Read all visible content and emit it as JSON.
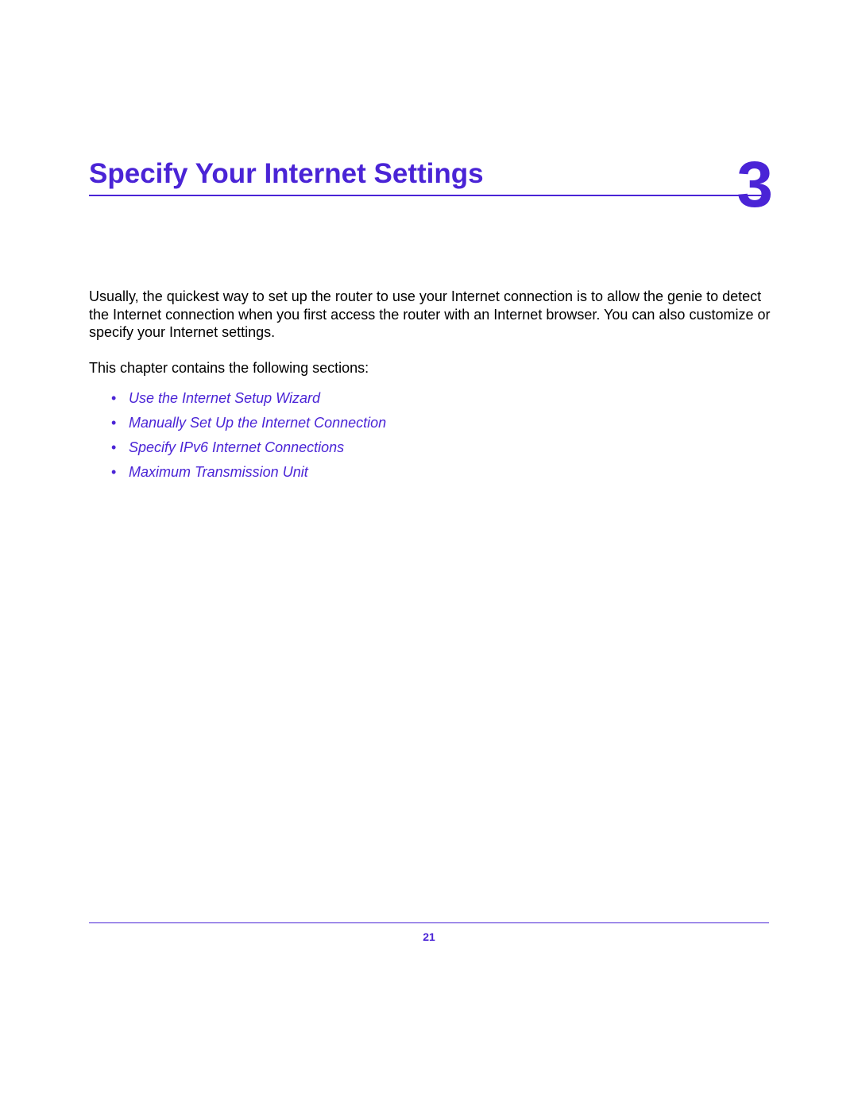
{
  "chapter": {
    "title": "Specify Your Internet Settings",
    "number": "3",
    "hidden_caption": ""
  },
  "body": {
    "intro": "Usually, the quickest way to set up the router to use your Internet connection is to allow the genie to detect the Internet connection when you first access the router with an Internet browser. You can also customize or specify your Internet settings.",
    "lead": "This chapter contains the following sections:",
    "sections": [
      "Use the Internet Setup Wizard",
      "Manually Set Up the Internet Connection",
      "Specify IPv6 Internet Connections",
      "Maximum Transmission Unit"
    ]
  },
  "footer": {
    "page_number": "21"
  }
}
